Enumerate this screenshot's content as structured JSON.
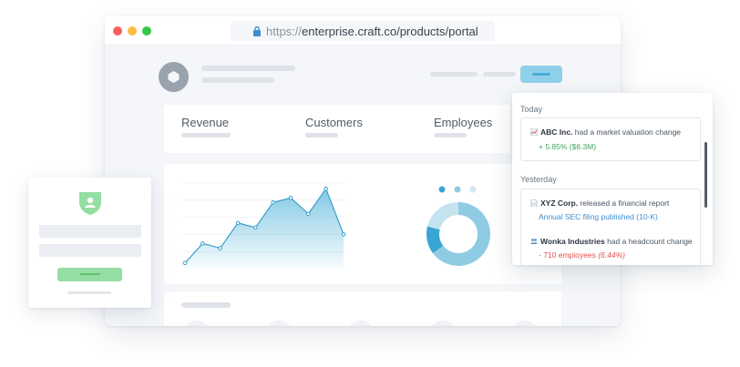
{
  "browser": {
    "url_scheme": "https://",
    "url_rest": "enterprise.craft.co/products/portal"
  },
  "stats": {
    "revenue_label": "Revenue",
    "customers_label": "Customers",
    "employees_label": "Employees"
  },
  "chart_data": {
    "type": "area",
    "x": [
      0,
      1,
      2,
      3,
      4,
      5,
      6,
      7,
      8,
      9
    ],
    "y": [
      5,
      22,
      18,
      40,
      36,
      58,
      62,
      48,
      70,
      30
    ],
    "color": "#5bb8dc"
  },
  "donut": {
    "dots": [
      "#3aa5d2",
      "#8fcbe3",
      "#cfe8f3"
    ],
    "slices": [
      {
        "value": 55,
        "color": "#8fcbe3"
      },
      {
        "value": 12,
        "color": "#3aa5d2"
      },
      {
        "value": 18,
        "color": "#c4e3ef"
      }
    ]
  },
  "feed": {
    "today_label": "Today",
    "yesterday_label": "Yesterday",
    "items": [
      {
        "icon": "chart-emoji-icon",
        "company": "ABC Inc.",
        "text": " had a market valuation change",
        "detail": "+ 5.85% ($6.3M)",
        "detail_color": "green"
      },
      {
        "icon": "document-emoji-icon",
        "company": "XYZ Corp.",
        "text": " released a financial report",
        "detail": "Annual SEC filing published (10-K)",
        "detail_color": "blue"
      },
      {
        "icon": "people-emoji-icon",
        "company": "Wonka Industries",
        "text": " had a headcount change",
        "detail_prefix": "- 710 employees ",
        "detail_suffix": "(6.44%)",
        "detail_color": "red"
      }
    ]
  }
}
